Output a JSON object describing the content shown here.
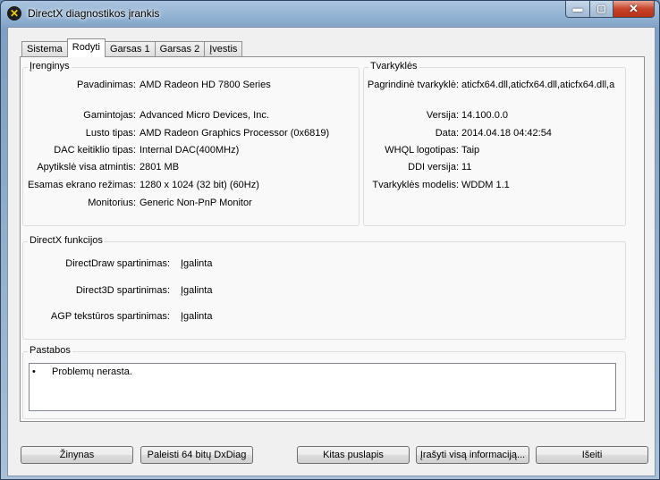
{
  "window": {
    "title": "DirectX diagnostikos įrankis",
    "min_glyph": "▬",
    "max_glyph": "▢",
    "close_glyph": "✕",
    "app_icon_glyph": "✕"
  },
  "tabs": [
    {
      "label": "Sistema",
      "active": false
    },
    {
      "label": "Rodyti",
      "active": true
    },
    {
      "label": "Garsas 1",
      "active": false
    },
    {
      "label": "Garsas 2",
      "active": false
    },
    {
      "label": "Įvestis",
      "active": false
    }
  ],
  "device": {
    "title": "Įrenginys",
    "rows": [
      {
        "label": "Pavadinimas:",
        "value": "AMD Radeon HD 7800 Series"
      },
      {
        "label": "Gamintojas:",
        "value": "Advanced Micro Devices, Inc."
      },
      {
        "label": "Lusto tipas:",
        "value": "AMD Radeon Graphics Processor (0x6819)"
      },
      {
        "label": "DAC keitiklio tipas:",
        "value": "Internal DAC(400MHz)"
      },
      {
        "label": "Apytikslė visa atmintis:",
        "value": "2801 MB"
      },
      {
        "label": "Esamas ekrano režimas:",
        "value": "1280 x 1024 (32 bit) (60Hz)"
      },
      {
        "label": "Monitorius:",
        "value": "Generic Non-PnP Monitor"
      }
    ]
  },
  "drivers": {
    "title": "Tvarkyklės",
    "rows": [
      {
        "label": "Pagrindinė tvarkyklė:",
        "value": "aticfx64.dll,aticfx64.dll,aticfx64.dll,a"
      },
      {
        "label": "Versija:",
        "value": "14.100.0.0"
      },
      {
        "label": "Data:",
        "value": "2014.04.18 04:42:54"
      },
      {
        "label": "WHQL logotipas:",
        "value": "Taip"
      },
      {
        "label": "DDI versija:",
        "value": "11"
      },
      {
        "label": "Tvarkyklės modelis:",
        "value": "WDDM 1.1"
      }
    ]
  },
  "features": {
    "title": "DirectX funkcijos",
    "rows": [
      {
        "label": "DirectDraw spartinimas:",
        "value": "Įgalinta"
      },
      {
        "label": "Direct3D spartinimas:",
        "value": "Įgalinta"
      },
      {
        "label": "AGP tekstūros spartinimas:",
        "value": "Įgalinta"
      }
    ]
  },
  "notes": {
    "title": "Pastabos",
    "bullet": "•",
    "text": "Problemų nerasta."
  },
  "buttons": {
    "help": "Žinynas",
    "run64": "Paleisti 64 bitų DxDiag",
    "next_page": "Kitas puslapis",
    "save_all": "Įrašyti visą informaciją...",
    "exit": "Išeiti"
  }
}
